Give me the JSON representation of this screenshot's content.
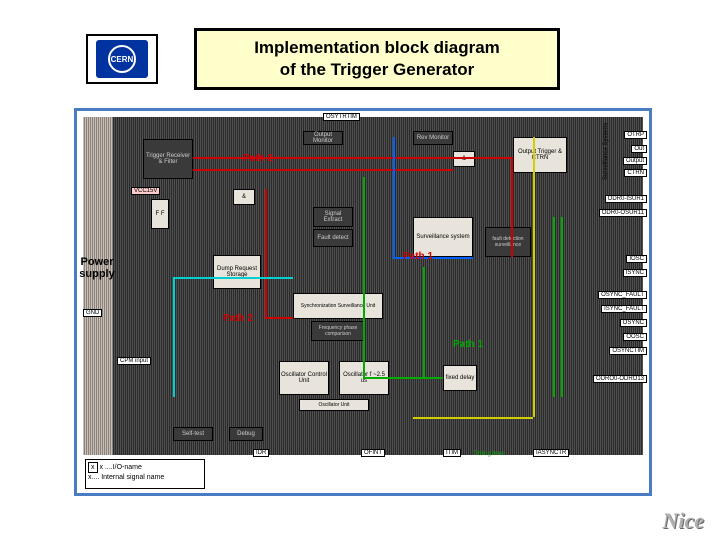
{
  "logo": {
    "text": "CERN"
  },
  "title": "Implementation block diagram\nof the Trigger Generator",
  "diagram": {
    "power_label": "Power supply",
    "top_bus": "OSYTRTIM",
    "paths": {
      "p2a": "Path 2",
      "p1a": "Path 1",
      "p2b": "Path 2",
      "p1b": "Path 1"
    },
    "blocks": {
      "trg_rcv": "Trigger Receiver & Filter",
      "vcc": "VCC15V",
      "ff1": "F F",
      "and1": "&",
      "and2": "&",
      "extract": "Signal Extract",
      "fault": "Fault detect",
      "dump_req": "Dump Request Storage",
      "surv": "Surveillance system",
      "sync_unit": "Synchronization Surveillance Unit",
      "freq_comp": "Frequency phase comparison",
      "fault_surv": "fault detection surveillance",
      "trig_out": "Output Trigger & CTRN",
      "osc_ctrl": "Oscillator Control Unit",
      "osc_free": "Oscillator f ~2.5 us",
      "osc_unit": "Oscillator Unit",
      "fixed_delay": "fixed delay",
      "out_mon": "Output Monitor",
      "rev_mon": "Rev Monitor",
      "selftest": "Self-test",
      "dbg": "Debug"
    },
    "right_tags": {
      "otrp": "OTRP",
      "out": "Out",
      "output": "Output",
      "ctrn": "CTRN",
      "isur1": "ODR0-ISUR1",
      "osur11": "ODR0-OSUR11",
      "surv_sys": "Surveillance Systems",
      "iosc": "IOSC",
      "isync": "ISYNC",
      "osync_fault": "OSYNC_FAULT",
      "isync_fault": "ISYNC_FAULT",
      "osync": "OSYNC",
      "oosc": "OOSC",
      "osynctim": "OSYNCTIM",
      "odro": "ODRO0-ODRO13"
    },
    "left_tags": {
      "gnd": "GND",
      "cpm": "CPM input"
    },
    "bottom_tags": {
      "idr": "IDR",
      "ofint": "OFINT",
      "itim": "ITIM",
      "iasynctr": "IASYNCTR",
      "timing": "Timing lines"
    },
    "legend": {
      "l1": "x ....I/O-name",
      "l2": "x.... Internal signal name"
    }
  },
  "footer": {
    "nice": "Nice"
  }
}
